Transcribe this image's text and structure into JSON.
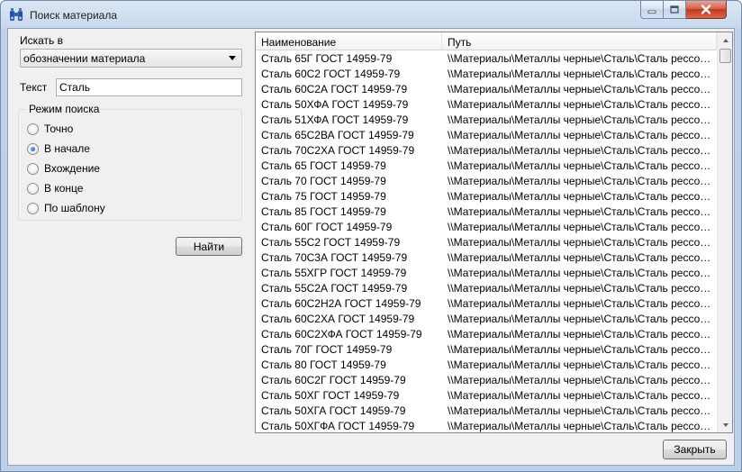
{
  "window": {
    "title": "Поиск материала"
  },
  "search": {
    "search_in_label": "Искать в",
    "search_in_value": "обозначении материала",
    "text_label": "Текст",
    "text_value": "Сталь",
    "mode_label": "Режим поиска",
    "modes": [
      {
        "label": "Точно",
        "checked": false
      },
      {
        "label": "В начале",
        "checked": true
      },
      {
        "label": "Вхождение",
        "checked": false
      },
      {
        "label": "В конце",
        "checked": false
      },
      {
        "label": "По шаблону",
        "checked": false
      }
    ],
    "find_label": "Найти"
  },
  "results": {
    "columns": [
      "Наименование",
      "Путь"
    ],
    "rows": [
      [
        "Сталь 65Г ГОСТ 14959-79",
        "\\\\Материалы\\Металлы черные\\Сталь\\Сталь рессорно..."
      ],
      [
        "Сталь 60С2 ГОСТ 14959-79",
        "\\\\Материалы\\Металлы черные\\Сталь\\Сталь рессорно..."
      ],
      [
        "Сталь 60С2А ГОСТ 14959-79",
        "\\\\Материалы\\Металлы черные\\Сталь\\Сталь рессорно..."
      ],
      [
        "Сталь 50ХФА ГОСТ 14959-79",
        "\\\\Материалы\\Металлы черные\\Сталь\\Сталь рессорно..."
      ],
      [
        "Сталь 51ХФА ГОСТ 14959-79",
        "\\\\Материалы\\Металлы черные\\Сталь\\Сталь рессорно..."
      ],
      [
        "Сталь 65С2ВА ГОСТ 14959-79",
        "\\\\Материалы\\Металлы черные\\Сталь\\Сталь рессорно..."
      ],
      [
        "Сталь 70С2ХА ГОСТ 14959-79",
        "\\\\Материалы\\Металлы черные\\Сталь\\Сталь рессорно..."
      ],
      [
        "Сталь 65 ГОСТ 14959-79",
        "\\\\Материалы\\Металлы черные\\Сталь\\Сталь рессорно..."
      ],
      [
        "Сталь 70 ГОСТ 14959-79",
        "\\\\Материалы\\Металлы черные\\Сталь\\Сталь рессорно..."
      ],
      [
        "Сталь 75 ГОСТ 14959-79",
        "\\\\Материалы\\Металлы черные\\Сталь\\Сталь рессорно..."
      ],
      [
        "Сталь 85 ГОСТ 14959-79",
        "\\\\Материалы\\Металлы черные\\Сталь\\Сталь рессорно..."
      ],
      [
        "Сталь 60Г ГОСТ 14959-79",
        "\\\\Материалы\\Металлы черные\\Сталь\\Сталь рессорно..."
      ],
      [
        "Сталь 55С2 ГОСТ 14959-79",
        "\\\\Материалы\\Металлы черные\\Сталь\\Сталь рессорно..."
      ],
      [
        "Сталь 70С3А ГОСТ 14959-79",
        "\\\\Материалы\\Металлы черные\\Сталь\\Сталь рессорно..."
      ],
      [
        "Сталь 55ХГР ГОСТ 14959-79",
        "\\\\Материалы\\Металлы черные\\Сталь\\Сталь рессорно..."
      ],
      [
        "Сталь 55С2А ГОСТ 14959-79",
        "\\\\Материалы\\Металлы черные\\Сталь\\Сталь рессорно..."
      ],
      [
        "Сталь 60С2Н2А ГОСТ 14959-79",
        "\\\\Материалы\\Металлы черные\\Сталь\\Сталь рессорно..."
      ],
      [
        "Сталь 60С2ХА ГОСТ 14959-79",
        "\\\\Материалы\\Металлы черные\\Сталь\\Сталь рессорно..."
      ],
      [
        "Сталь 60С2ХФА ГОСТ 14959-79",
        "\\\\Материалы\\Металлы черные\\Сталь\\Сталь рессорно..."
      ],
      [
        "Сталь 70Г ГОСТ 14959-79",
        "\\\\Материалы\\Металлы черные\\Сталь\\Сталь рессорно..."
      ],
      [
        "Сталь 80 ГОСТ 14959-79",
        "\\\\Материалы\\Металлы черные\\Сталь\\Сталь рессорно..."
      ],
      [
        "Сталь 60С2Г ГОСТ 14959-79",
        "\\\\Материалы\\Металлы черные\\Сталь\\Сталь рессорно..."
      ],
      [
        "Сталь 50ХГ ГОСТ 14959-79",
        "\\\\Материалы\\Металлы черные\\Сталь\\Сталь рессорно..."
      ],
      [
        "Сталь 50ХГА ГОСТ 14959-79",
        "\\\\Материалы\\Металлы черные\\Сталь\\Сталь рессорно..."
      ],
      [
        "Сталь 50ХГФА ГОСТ 14959-79",
        "\\\\Материалы\\Металлы черные\\Сталь\\Сталь рессорно..."
      ]
    ]
  },
  "footer": {
    "close_label": "Закрыть"
  },
  "icons": {
    "app": "binoculars-icon",
    "minimize": "minimize-icon",
    "maximize": "maximize-icon",
    "close": "close-icon",
    "combo_arrow": "chevron-down-icon",
    "scroll_up": "arrow-up-icon",
    "scroll_down": "arrow-down-icon"
  },
  "colors": {
    "titlebar": "#c9d9ed",
    "close_button": "#c2381c",
    "dialog_background": "#f0f0f0",
    "radio_dot": "#0c4fa8"
  }
}
